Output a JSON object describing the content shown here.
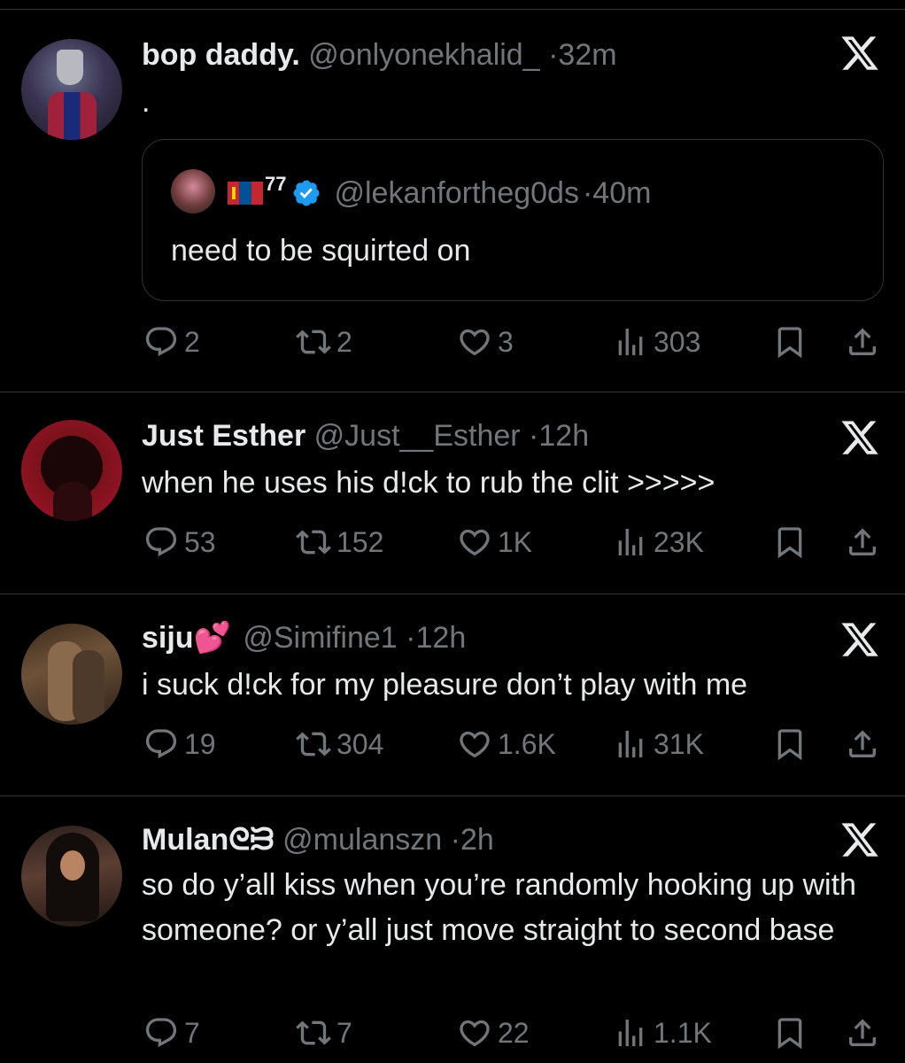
{
  "tweets": [
    {
      "name": "bop daddy.",
      "handle": "@onlyonekhalid_",
      "dot": "·",
      "time": "32m",
      "text": ".",
      "quote": {
        "name_suffix": "77",
        "handle": "@lekanfortheg0ds",
        "dot": "·",
        "time": "40m",
        "text": "need to be squirted on"
      },
      "replies": "2",
      "reposts": "2",
      "likes": "3",
      "views": "303"
    },
    {
      "name": "Just Esther",
      "handle": "@Just__Esther",
      "dot": "·",
      "time": "12h",
      "text": "when he uses his d!ck to rub the clit >>>>>",
      "replies": "53",
      "reposts": "152",
      "likes": "1K",
      "views": "23K"
    },
    {
      "name": "siju💕",
      "handle": "@Simifine1",
      "dot": "·",
      "time": "12h",
      "text": "i suck d!ck for my pleasure don’t play with me",
      "replies": "19",
      "reposts": "304",
      "likes": "1.6K",
      "views": "31K"
    },
    {
      "name": "Mulanᘓᙣ",
      "handle": "@mulanszn",
      "dot": "·",
      "time": "2h",
      "text": "so do y’all kiss when you’re randomly hooking up with someone? or y’all just move straight to second base",
      "replies": "7",
      "reposts": "7",
      "likes": "22",
      "views": "1.1K"
    }
  ],
  "colors": {
    "background": "#000000",
    "text": "#e7e9ea",
    "muted": "#71767b",
    "divider": "#2f3336",
    "verified": "#1d9bf0"
  },
  "icons": [
    "reply-icon",
    "repost-icon",
    "like-icon",
    "views-icon",
    "bookmark-icon",
    "share-icon",
    "x-logo-icon",
    "verified-badge-icon",
    "mongolia-flag-icon"
  ]
}
